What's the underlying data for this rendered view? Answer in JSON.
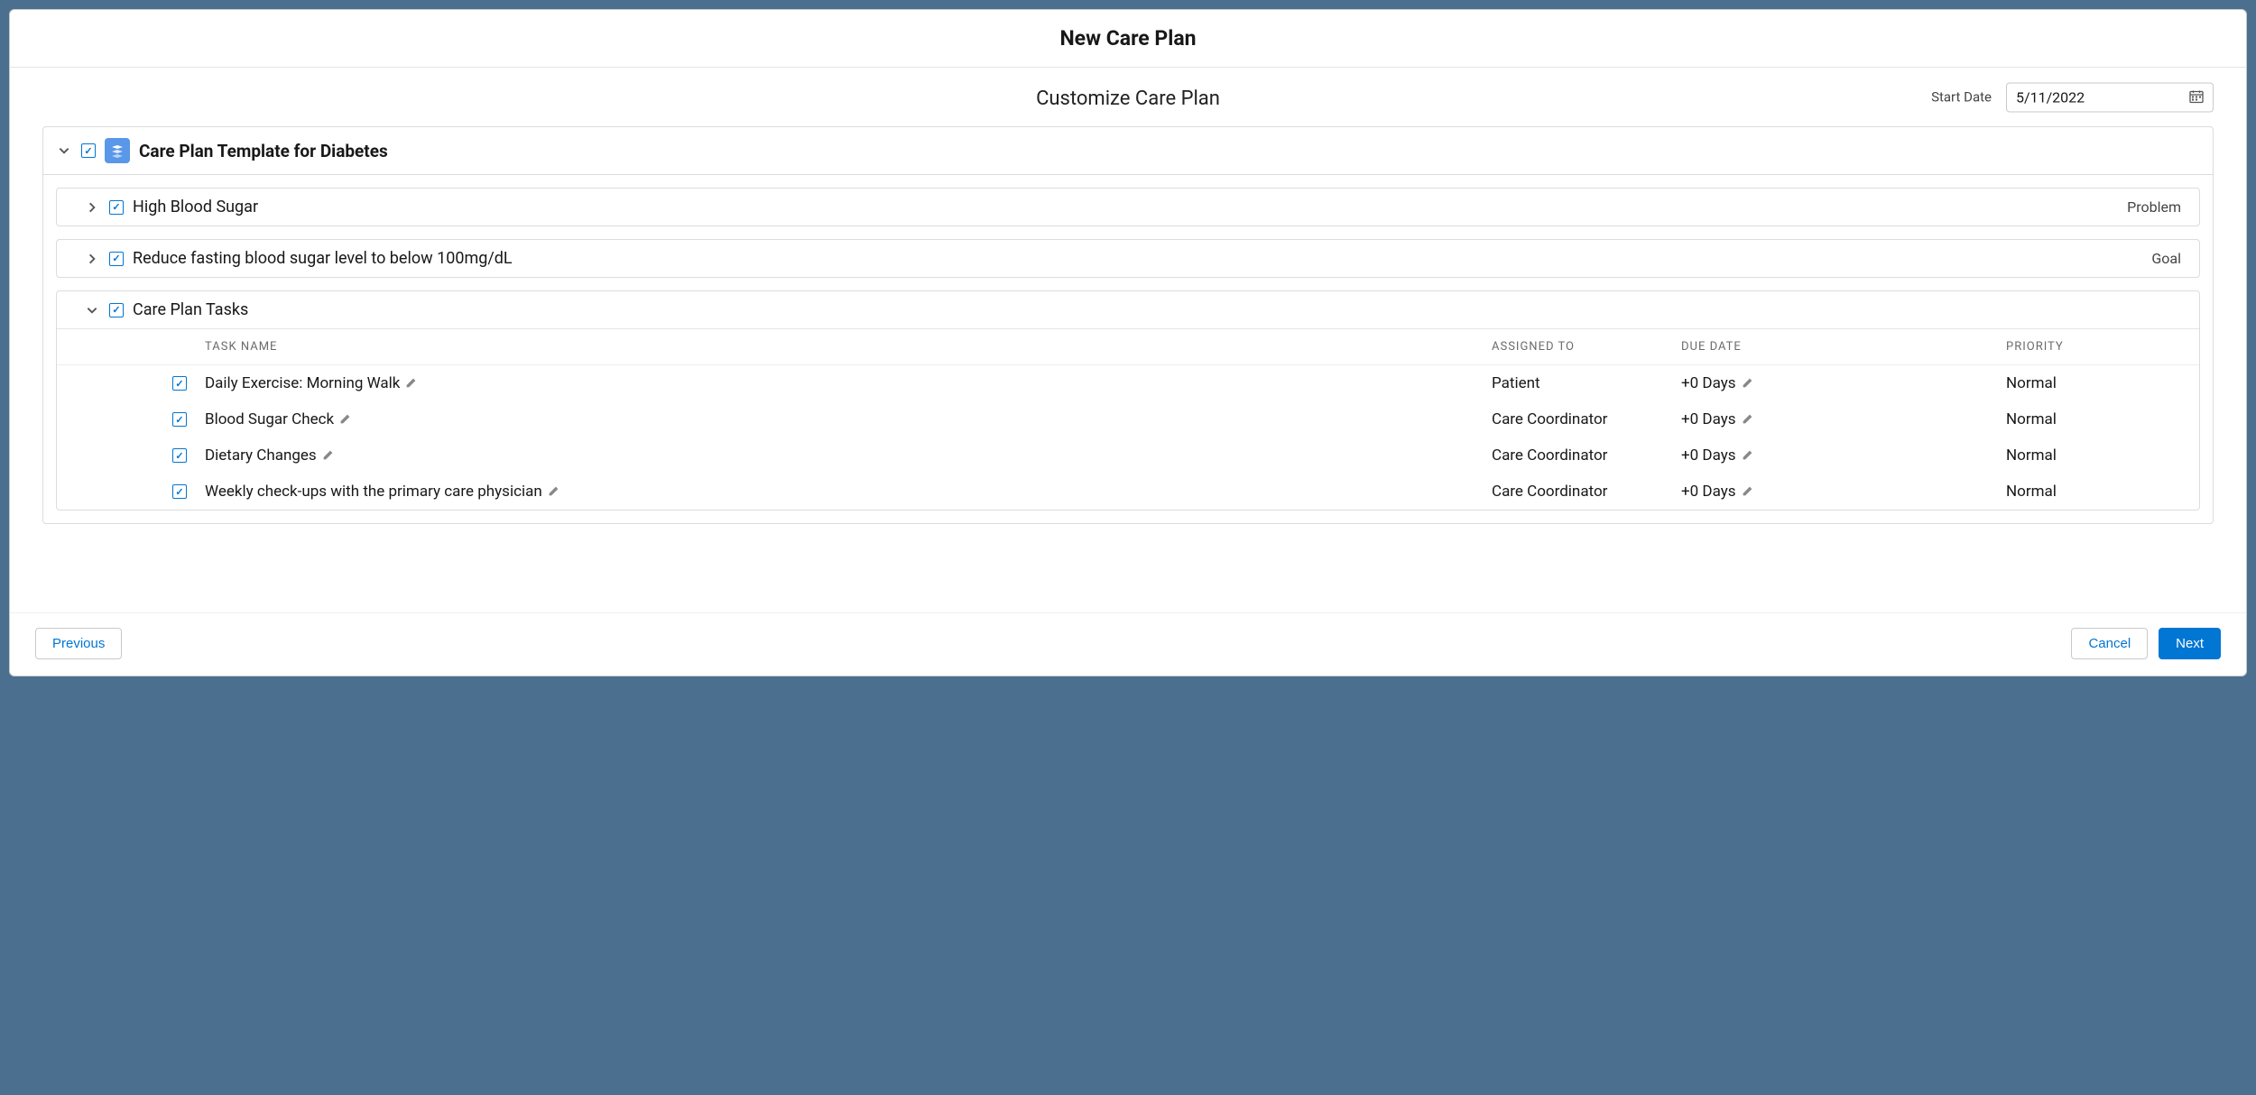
{
  "modal": {
    "title": "New Care Plan",
    "subtitle": "Customize Care Plan"
  },
  "start_date": {
    "label": "Start Date",
    "value": "5/11/2022"
  },
  "template": {
    "title": "Care Plan Template for Diabetes"
  },
  "problem": {
    "title": "High Blood Sugar",
    "tag": "Problem"
  },
  "goal": {
    "title": "Reduce fasting blood sugar level to below 100mg/dL",
    "tag": "Goal"
  },
  "tasks_section": {
    "title": "Care Plan Tasks",
    "cols": {
      "name": "TASK NAME",
      "assigned": "ASSIGNED TO",
      "due": "DUE DATE",
      "priority": "PRIORITY"
    }
  },
  "tasks": [
    {
      "name": "Daily Exercise: Morning Walk",
      "assigned": "Patient",
      "due": "+0 Days",
      "priority": "Normal"
    },
    {
      "name": "Blood Sugar Check",
      "assigned": "Care Coordinator",
      "due": "+0 Days",
      "priority": "Normal"
    },
    {
      "name": "Dietary Changes",
      "assigned": "Care Coordinator",
      "due": "+0 Days",
      "priority": "Normal"
    },
    {
      "name": "Weekly check-ups with the primary care physician",
      "assigned": "Care Coordinator",
      "due": "+0 Days",
      "priority": "Normal"
    }
  ],
  "footer": {
    "previous": "Previous",
    "cancel": "Cancel",
    "next": "Next"
  }
}
